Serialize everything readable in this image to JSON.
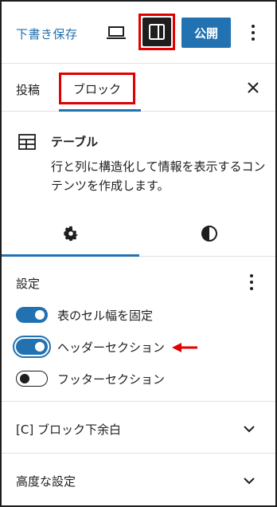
{
  "toolbar": {
    "save_draft_label": "下書き保存",
    "publish_label": "公開",
    "preview_icon": "laptop-icon",
    "settings_icon": "sidebar-toggle-icon",
    "more_icon": "vertical-ellipsis-icon"
  },
  "tabs": {
    "post_label": "投稿",
    "block_label": "ブロック",
    "close_icon": "close-icon"
  },
  "block": {
    "icon": "table-icon",
    "title": "テーブル",
    "description": "行と列に構造化して情報を表示するコンテンツを作成します。"
  },
  "sub_tabs": {
    "settings_icon": "gear-icon",
    "styles_icon": "half-circle-contrast-icon"
  },
  "settings": {
    "title": "設定",
    "toggles": [
      {
        "label": "表のセル幅を固定",
        "on": true
      },
      {
        "label": "ヘッダーセクション",
        "on": true
      },
      {
        "label": "フッターセクション",
        "on": false
      }
    ]
  },
  "sections": [
    {
      "label": "[C] ブロック下余白"
    },
    {
      "label": "高度な設定"
    }
  ],
  "colors": {
    "accent": "#2271b1",
    "highlight_red": "#e00000",
    "dark": "#1e1e1e"
  }
}
